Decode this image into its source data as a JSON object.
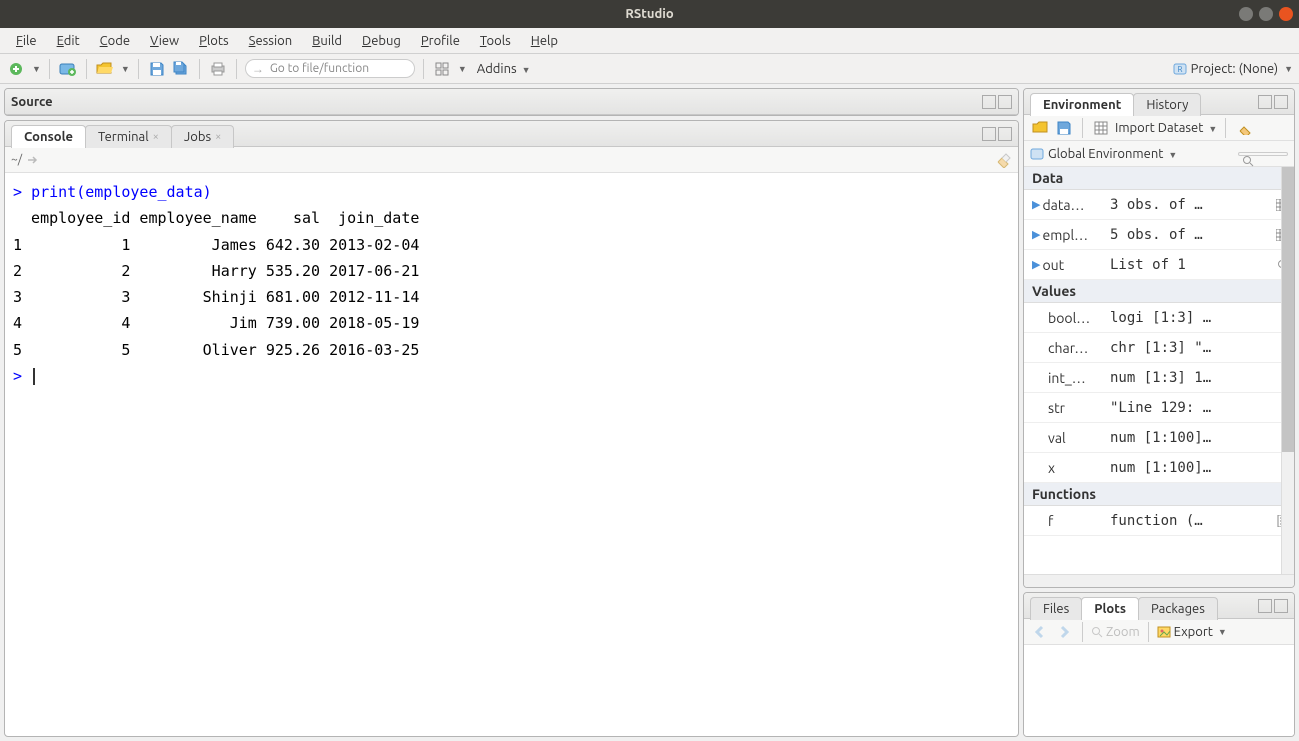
{
  "app": {
    "title": "RStudio"
  },
  "menu": [
    "File",
    "Edit",
    "Code",
    "View",
    "Plots",
    "Session",
    "Build",
    "Debug",
    "Profile",
    "Tools",
    "Help"
  ],
  "toolbar": {
    "goto_placeholder": "Go to file/function",
    "addins_label": "Addins",
    "project_label": "Project: (None)"
  },
  "panes": {
    "source_label": "Source",
    "console_tab": "Console",
    "terminal_tab": "Terminal",
    "jobs_tab": "Jobs",
    "console_path": "~/",
    "env_tab": "Environment",
    "history_tab": "History",
    "import_label": "Import Dataset",
    "global_env_label": "Global Environment",
    "files_tab": "Files",
    "plots_tab": "Plots",
    "packages_tab": "Packages",
    "zoom_label": "Zoom",
    "export_label": "Export"
  },
  "console": {
    "prompt": ">",
    "command": "print(employee_data)",
    "header": "  employee_id employee_name    sal  join_date",
    "rows": [
      "1           1         James 642.30 2013-02-04",
      "2           2         Harry 535.20 2017-06-21",
      "3           3        Shinji 681.00 2012-11-14",
      "4           4           Jim 739.00 2018-05-19",
      "5           5        Oliver 925.26 2016-03-25"
    ]
  },
  "environment": {
    "data_label": "Data",
    "values_label": "Values",
    "functions_label": "Functions",
    "data_items": [
      {
        "name": "data…",
        "val": "3 obs. of …"
      },
      {
        "name": "empl…",
        "val": "5 obs. of …"
      },
      {
        "name": "out",
        "val": "List of 1"
      }
    ],
    "value_items": [
      {
        "name": "bool…",
        "val": "logi [1:3] …"
      },
      {
        "name": "char…",
        "val": "chr [1:3] \"…"
      },
      {
        "name": "int_…",
        "val": "num [1:3] 1…"
      },
      {
        "name": "str",
        "val": "\"Line 129: …"
      },
      {
        "name": "val",
        "val": "num [1:100]…"
      },
      {
        "name": "x",
        "val": "num [1:100]…"
      }
    ],
    "function_items": [
      {
        "name": "f",
        "val": "function (…"
      }
    ]
  }
}
